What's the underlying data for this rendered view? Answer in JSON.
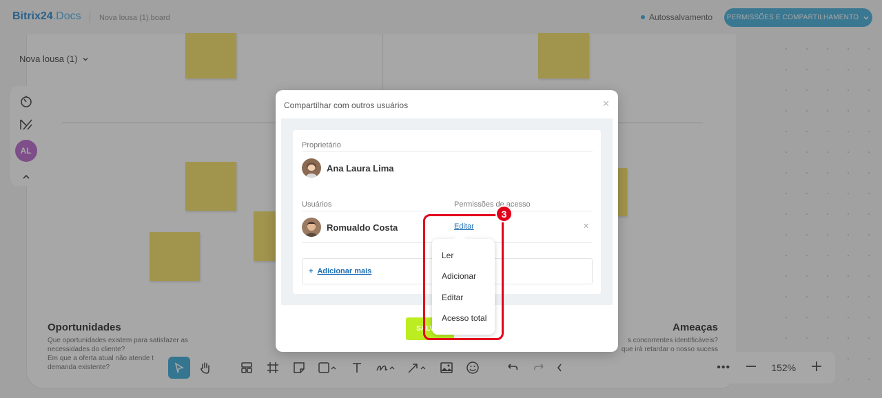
{
  "header": {
    "brand_main": "Bitrix24",
    "brand_suffix": ".Docs",
    "file_name": "Nova lousa (1).board",
    "autosave_label": "Autossalvamento",
    "share_button_label": "PERMISSÕES E COMPARTILHAMENTO"
  },
  "board": {
    "title": "Nova lousa (1)",
    "avatar_initials": "AL",
    "opportunities": {
      "heading": "Oportunidades",
      "line1": "Que oportunidades existem para satisfazer as",
      "line2": "necessidades do cliente?",
      "line3": "Em que a oferta atual não atende t",
      "line4": "demanda existente?"
    },
    "threats": {
      "heading": "Ameaças",
      "line1": "s concorrentes identificáveis?",
      "line2": "que irá retardar o nosso sucess"
    },
    "zoom_level": "152%",
    "sticky_color": "#f5dc5c"
  },
  "dialog": {
    "title": "Compartilhar com outros usuários",
    "owner_label": "Proprietário",
    "owner_name": "Ana Laura Lima",
    "users_label": "Usuários",
    "permissions_label": "Permissões de acesso",
    "user_name": "Romualdo Costa",
    "user_permission": "Editar",
    "add_more_label": "Adicionar mais",
    "save_label": "SALVAR"
  },
  "dropdown": {
    "options": [
      "Ler",
      "Adicionar",
      "Editar",
      "Acesso total"
    ]
  },
  "callout": {
    "step_number": "3",
    "color": "#e3001b"
  },
  "colors": {
    "accent": "#2fa4d6",
    "save_button": "#bbed21",
    "link": "#1f6fb5"
  }
}
